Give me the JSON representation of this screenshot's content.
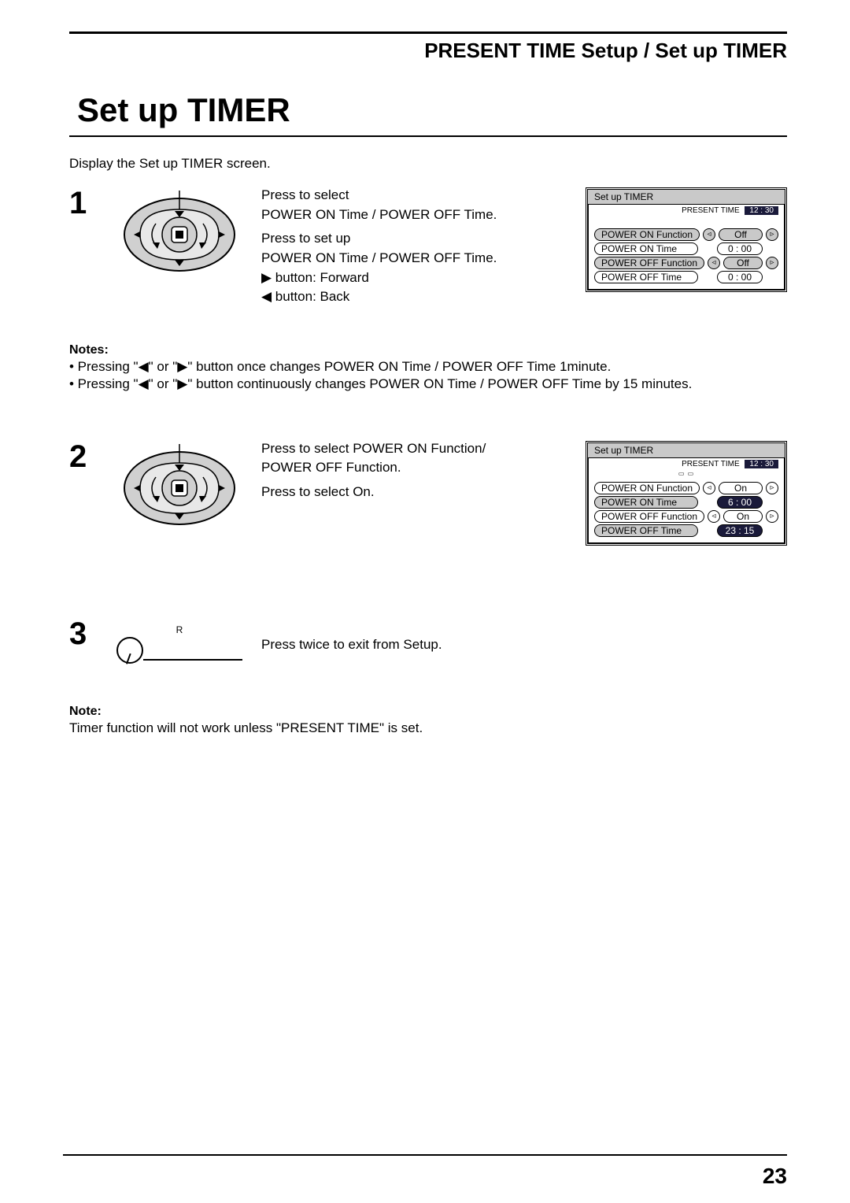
{
  "header": {
    "breadcrumb": "PRESENT TIME Setup / Set up TIMER",
    "title": "Set up TIMER",
    "intro_line": "Display the Set up TIMER screen."
  },
  "step1": {
    "num": "1",
    "line1": "Press to select",
    "line2": "POWER ON Time / POWER OFF Time.",
    "line3": "Press to set up",
    "line4": "POWER ON Time / POWER OFF Time.",
    "line5_prefix": "▶",
    "line5_text": " button: Forward",
    "line6_prefix": "◀",
    "line6_text": " button: Back"
  },
  "osd1": {
    "title": "Set up TIMER",
    "present_label": "PRESENT TIME",
    "present_value": "12 : 30",
    "rows": [
      {
        "label": "POWER ON Function",
        "value": "Off",
        "arrows": true,
        "selected": true,
        "picked": false
      },
      {
        "label": "POWER ON Time",
        "value": "0 : 00",
        "arrows": false,
        "selected": false,
        "picked": false
      },
      {
        "label": "POWER OFF Function",
        "value": "Off",
        "arrows": true,
        "selected": true,
        "picked": false
      },
      {
        "label": "POWER OFF Time",
        "value": "0 : 00",
        "arrows": false,
        "selected": false,
        "picked": false
      }
    ]
  },
  "notes_block": {
    "title": "Notes:",
    "b1_pre": "• Pressing \"",
    "b1_mid": "\" or \"",
    "b1_tri1": "◀",
    "b1_tri2": "▶",
    "b1_post": "\" button once changes POWER ON Time / POWER OFF Time 1minute.",
    "b2_pre": "• Pressing \"",
    "b2_mid": "\" or \"",
    "b2_tri1": "◀",
    "b2_tri2": "▶",
    "b2_post": "\" button continuously changes POWER ON Time / POWER OFF Time by 15 minutes."
  },
  "step2": {
    "num": "2",
    "line1": "Press to select POWER ON Function/",
    "line2": "POWER OFF Function.",
    "line3": "Press to select On."
  },
  "osd2": {
    "title": "Set up TIMER",
    "present_label": "PRESENT TIME",
    "present_value": "12 : 30",
    "rows": [
      {
        "label": "POWER ON Function",
        "value": "On",
        "arrows": true,
        "selected": false,
        "picked": false
      },
      {
        "label": "POWER ON Time",
        "value": "6 : 00",
        "arrows": false,
        "selected": true,
        "picked": true
      },
      {
        "label": "POWER OFF Function",
        "value": "On",
        "arrows": true,
        "selected": false,
        "picked": false
      },
      {
        "label": "POWER OFF Time",
        "value": "23 : 15",
        "arrows": false,
        "selected": true,
        "picked": true
      }
    ]
  },
  "step3": {
    "num": "3",
    "btn_label": "R",
    "text": "Press twice to exit from Setup."
  },
  "note_block": {
    "title": "Note:",
    "text": "Timer function will not work unless \"PRESENT TIME\" is set."
  },
  "page_number": "23"
}
